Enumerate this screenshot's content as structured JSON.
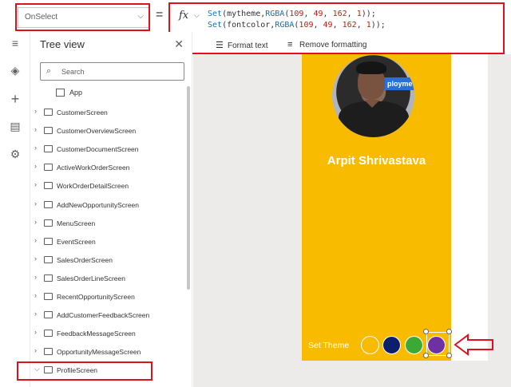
{
  "property_select": {
    "value": "OnSelect"
  },
  "formula_bar": {
    "equals": "=",
    "fx_label": "fx",
    "lines": [
      [
        "Set",
        "(mytheme,",
        "RGBA",
        "(",
        "109",
        ", ",
        "49",
        ", ",
        "162",
        ", ",
        "1",
        "));"
      ],
      [
        "Set",
        "(fontcolor,",
        "RGBA",
        "(",
        "109",
        ", ",
        "49",
        ", ",
        "162",
        ", ",
        "1",
        "));"
      ]
    ],
    "format_text": "Format text",
    "remove_formatting": "Remove formatting"
  },
  "tree_view": {
    "title": "Tree view",
    "search_placeholder": "Search",
    "app_label": "App",
    "screens": [
      "CustomerScreen",
      "CustomerOverviewScreen",
      "CustomerDocumentScreen",
      "ActiveWorkOrderScreen",
      "WorkOrderDetailScreen",
      "AddNewOpportunityScreen",
      "MenuScreen",
      "EventScreen",
      "SalesOrderScreen",
      "SalesOrderLineScreen",
      "RecentOpportunityScreen",
      "AddCustomerFeedbackScreen",
      "FeedbackMessageScreen",
      "OpportunityMessageScreen",
      "ProfileScreen"
    ],
    "expanded_screen": "ProfileScreen"
  },
  "canvas": {
    "profile_name": "Arpit Shrivastava",
    "avatar_banner_text": "ployme",
    "set_theme_label": "Set Theme",
    "swatches": [
      "#f9bb00",
      "#0c1f6b",
      "#3aaa35",
      "#6d31a2"
    ],
    "screen_color": "#f9bb00"
  },
  "colors": {
    "annotation_red": "#e0101c",
    "keyword_blue": "#0f6fbf",
    "number_red": "#c9190b"
  }
}
